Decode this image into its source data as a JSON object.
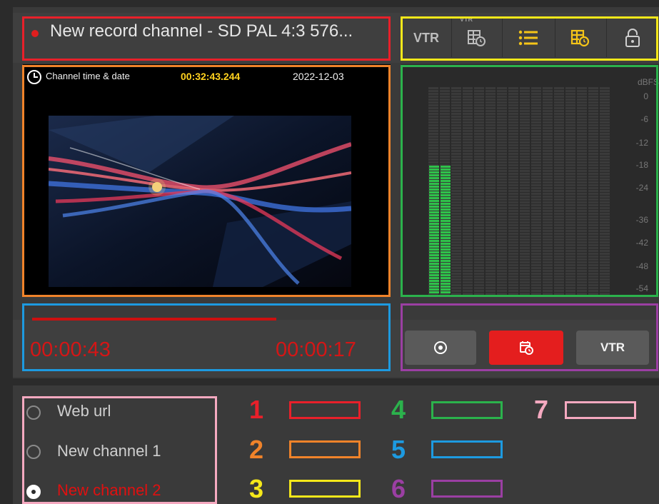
{
  "header": {
    "channel_title": "New record channel - SD PAL 4:3 576...",
    "record_indicator": "recording-dot"
  },
  "toolbar": {
    "vtr_label": "VTR",
    "vtr_small_label": "VTR",
    "icons": [
      "vtr-schedule-icon",
      "list-icon",
      "schedule-grid-icon",
      "lock-icon"
    ]
  },
  "video": {
    "overlay_label": "Channel time & date",
    "time": "00:32:43.244",
    "date": "2022-12-03"
  },
  "meter": {
    "unit": "dBFS",
    "scale": [
      "0",
      "-6",
      "-12",
      "-18",
      "-24",
      "-36",
      "-42",
      "-48",
      "-54"
    ],
    "levels_db": [
      -17,
      -17
    ]
  },
  "transport": {
    "elapsed": "00:00:43",
    "remaining": "00:00:17",
    "progress_fraction": 0.72
  },
  "buttons": {
    "record_icon": "record-circle-icon",
    "schedule_icon": "calendar-clock-icon",
    "vtr_label": "VTR"
  },
  "sources": [
    {
      "label": "Web url",
      "selected": false
    },
    {
      "label": "New channel 1",
      "selected": false
    },
    {
      "label": "New channel 2",
      "selected": true
    }
  ],
  "legend": [
    {
      "num": "1",
      "color": "#e8202a"
    },
    {
      "num": "2",
      "color": "#f0832a"
    },
    {
      "num": "3",
      "color": "#f5e81a"
    },
    {
      "num": "4",
      "color": "#2bb24c"
    },
    {
      "num": "5",
      "color": "#1d9ae0"
    },
    {
      "num": "6",
      "color": "#9b3fa3"
    },
    {
      "num": "7",
      "color": "#f5a9c0"
    }
  ],
  "colors": {
    "accent_red": "#e01e1e",
    "time_yellow": "#ffd21f",
    "meter_green": "#2ec24a"
  }
}
